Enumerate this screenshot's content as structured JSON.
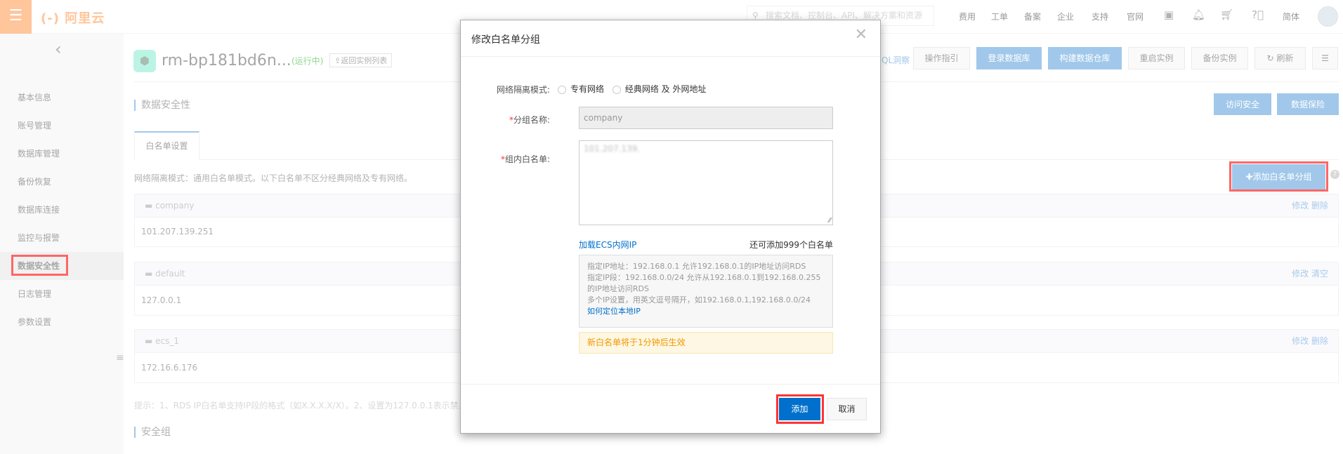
{
  "topbar": {
    "logo": "(-) 阿里云",
    "search_placeholder": "搜索文档、控制台、API、解决方案和资源",
    "nav": [
      "费用",
      "工单",
      "备案",
      "企业",
      "支持",
      "官网"
    ],
    "lang": "简体"
  },
  "sidebar": {
    "items": [
      "基本信息",
      "账号管理",
      "数据库管理",
      "备份恢复",
      "数据库连接",
      "监控与报警",
      "数据安全性",
      "日志管理",
      "参数设置"
    ],
    "active": "数据安全性"
  },
  "header": {
    "instance": "rm-bp181bd6n...",
    "status": "(运行中)",
    "back": "⇪返回实例列表",
    "ql_link": "QL洞察",
    "buttons": [
      "操作指引",
      "登录数据库",
      "构建数据仓库",
      "重启实例",
      "备份实例",
      "刷新"
    ]
  },
  "section": {
    "title": "数据安全性",
    "btn_access": "访问安全",
    "btn_insure": "数据保险",
    "tab": "白名单设置",
    "mode_text": "网络隔离模式：通用白名单模式。以下白名单不区分经典网络及专有网络。",
    "add_group": "添加白名单分组",
    "groups": [
      {
        "name": "company",
        "ip": "101.207.139.251",
        "actions": [
          "修改",
          "删除"
        ]
      },
      {
        "name": "default",
        "ip": "127.0.0.1",
        "actions": [
          "修改",
          "清空"
        ]
      },
      {
        "name": "ecs_1",
        "ip": "172.16.6.176",
        "actions": [
          "修改",
          "删除"
        ]
      }
    ],
    "hint": "提示：1、RDS IP白名单支持IP段的格式（如X.X.X.X/X）。2、设置为127.0.0.1表示禁止所",
    "security_group": "安全组"
  },
  "dialog": {
    "title": "修改白名单分组",
    "mode_label": "网络隔离模式:",
    "radio_vpc": "专有网络",
    "radio_classic": "经典网络 及 外网地址",
    "name_label": "分组名称:",
    "name_value": "company",
    "list_label": "组内白名单:",
    "list_value": "101.207.139.",
    "load_ecs": "加载ECS内网IP",
    "remaining": "还可添加999个白名单",
    "help": [
      "指定IP地址：192.168.0.1 允许192.168.0.1的IP地址访问RDS",
      "指定IP段：192.168.0.0/24 允许从192.168.0.1到192.168.0.255的IP地址访问RDS",
      "多个IP设置，用英文逗号隔开，如192.168.0.1,192.168.0.0/24"
    ],
    "help_link": "如何定位本地IP",
    "notice": "新白名单将于1分钟后生效",
    "ok": "添加",
    "cancel": "取消"
  }
}
